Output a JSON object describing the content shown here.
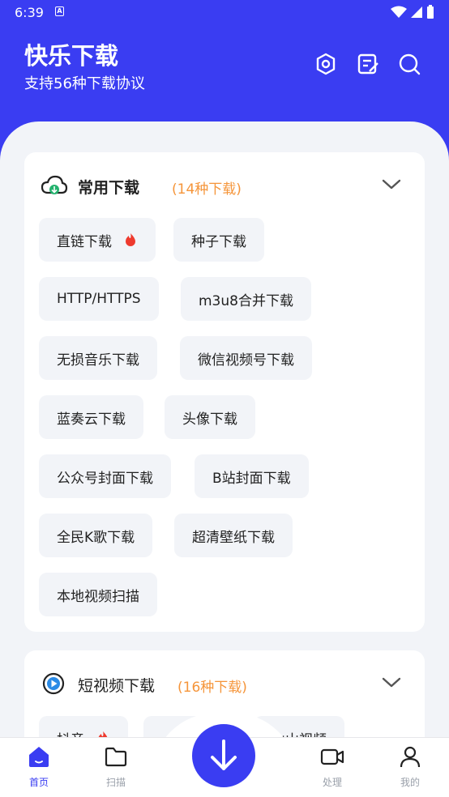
{
  "status": {
    "time": "6:39",
    "a_icon": "A"
  },
  "header": {
    "title": "快乐下载",
    "subtitle": "支持56种下载协议"
  },
  "card_common": {
    "title": "常用下载",
    "count": "(14种下载)",
    "tags": [
      "直链下载",
      "种子下载",
      "HTTP/HTTPS",
      "m3u8合并下载",
      "无损音乐下载",
      "微信视频号下载",
      "蓝奏云下载",
      "头像下载",
      "公众号封面下载",
      "B站封面下载",
      "全民K歌下载",
      "超清壁纸下载",
      "本地视频扫描"
    ]
  },
  "card_short": {
    "title": "短视频下载",
    "count": "(16种下载)",
    "tags": [
      "抖音",
      "",
      "火山视频"
    ]
  },
  "nav": {
    "home": "首页",
    "scan": "扫描",
    "process": "处理",
    "mine": "我的"
  },
  "colors": {
    "primary": "#3a3df2",
    "accent": "#f5953a",
    "background": "#f2f4f8"
  },
  "icons": [
    "settings-icon",
    "notes-icon",
    "search-icon",
    "cloud-download-icon",
    "play-circle-icon",
    "chevron-down-icon",
    "hot-flame-icon",
    "home-icon",
    "folder-icon",
    "download-icon",
    "video-icon",
    "user-icon"
  ]
}
